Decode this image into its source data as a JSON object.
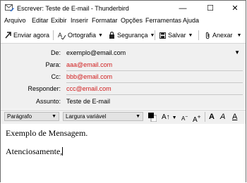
{
  "window": {
    "title": "Escrever: Teste de E-mail - Thunderbird"
  },
  "menu": [
    "Arquivo",
    "Editar",
    "Exibir",
    "Inserir",
    "Formatar",
    "Opções",
    "Ferramentas",
    "Ajuda"
  ],
  "toolbar": {
    "send": "Enviar agora",
    "spelling": "Ortografia",
    "security": "Segurança",
    "save": "Salvar",
    "attach": "Anexar"
  },
  "headers": {
    "from": {
      "label": "De:",
      "value": "exemplo@email.com"
    },
    "to": {
      "label": "Para:",
      "value": "aaa@email.com"
    },
    "cc": {
      "label": "Cc:",
      "value": "bbb@email.com"
    },
    "reply": {
      "label": "Responder:",
      "value": "ccc@email.com"
    },
    "subject": {
      "label": "Assunto:",
      "value": "Teste de E-mail"
    }
  },
  "format": {
    "paragraph": "Parágrafo",
    "font": "Largura variável"
  },
  "body": {
    "line1": "Exemplo de Mensagem.",
    "line2": "Atenciosamente,"
  },
  "colors": {
    "recipient": "#d11e1e",
    "header_bg": "#f0f0f0"
  }
}
